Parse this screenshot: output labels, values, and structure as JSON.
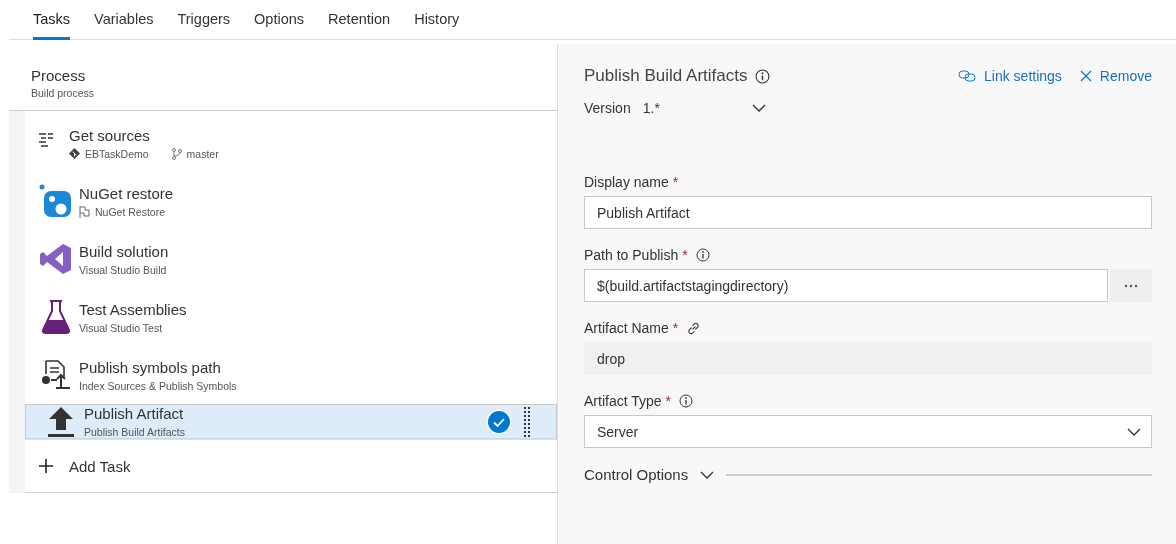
{
  "tabs": [
    {
      "label": "Tasks",
      "selected": true
    },
    {
      "label": "Variables",
      "selected": false
    },
    {
      "label": "Triggers",
      "selected": false
    },
    {
      "label": "Options",
      "selected": false
    },
    {
      "label": "Retention",
      "selected": false
    },
    {
      "label": "History",
      "selected": false
    }
  ],
  "process": {
    "title": "Process",
    "subtitle": "Build process"
  },
  "tasks": [
    {
      "kind": "sources",
      "name": "Get sources",
      "repo": "EBTaskDemo",
      "branch": "master",
      "selected": false
    },
    {
      "kind": "nuget",
      "name": "NuGet restore",
      "subtitle": "NuGet Restore",
      "selected": false
    },
    {
      "kind": "vsbuild",
      "name": "Build solution",
      "subtitle": "Visual Studio Build",
      "selected": false
    },
    {
      "kind": "vstest",
      "name": "Test Assemblies",
      "subtitle": "Visual Studio Test",
      "selected": false
    },
    {
      "kind": "symbols",
      "name": "Publish symbols path",
      "subtitle": "Index Sources & Publish Symbols",
      "selected": false
    },
    {
      "kind": "publish",
      "name": "Publish Artifact",
      "subtitle": "Publish Build Artifacts",
      "selected": true
    }
  ],
  "add_task": "Add Task",
  "details": {
    "title": "Publish Build Artifacts",
    "link_settings": "Link settings",
    "remove": "Remove",
    "version_label": "Version",
    "version": "1.*",
    "fields": [
      {
        "kind": "text",
        "label": "Display name",
        "required_mark": "*",
        "value": "Publish Artifact"
      },
      {
        "kind": "browse",
        "label": "Path to Publish",
        "required_mark": "*",
        "info_icon": true,
        "value": "$(build.artifactstagingdirectory)"
      },
      {
        "kind": "readonly",
        "label": "Artifact Name",
        "required_mark": "*",
        "link_icon": true,
        "value": "drop"
      },
      {
        "kind": "select",
        "label": "Artifact Type",
        "required_mark": "*",
        "info_icon": true,
        "value": "Server"
      }
    ],
    "control_options": {
      "label": "Control Options",
      "expanded": false
    }
  }
}
